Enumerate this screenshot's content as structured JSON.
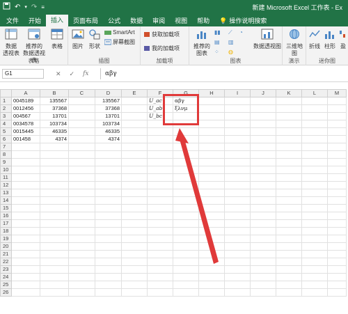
{
  "window": {
    "title": "新建 Microsoft Excel 工作表 - Ex"
  },
  "tabs": [
    {
      "label": "文件",
      "active": false
    },
    {
      "label": "开始",
      "active": false
    },
    {
      "label": "插入",
      "active": true
    },
    {
      "label": "页面布局",
      "active": false
    },
    {
      "label": "公式",
      "active": false
    },
    {
      "label": "数据",
      "active": false
    },
    {
      "label": "审阅",
      "active": false
    },
    {
      "label": "视图",
      "active": false
    },
    {
      "label": "帮助",
      "active": false
    },
    {
      "label": "操作说明搜索",
      "active": false
    }
  ],
  "ribbon": {
    "tables": {
      "btn1": "数据\n透视表",
      "btn2": "推荐的\n数据透视表",
      "btn3": "表格",
      "label": "表格"
    },
    "illustrations": {
      "btn1": "图片",
      "btn2": "形状",
      "smartart": "SmartArt",
      "screenshot": "屏幕截图",
      "label": "插图"
    },
    "addins": {
      "get": "获取加载项",
      "my": "我的加载项",
      "label": "加载项"
    },
    "charts": {
      "recommended": "推荐的\n图表",
      "pivotchart": "数据透视图",
      "label": "图表"
    },
    "tours": {
      "map3d": "三维地\n图",
      "label": "演示"
    },
    "sparklines": {
      "line": "折线",
      "column": "柱形",
      "winloss": "盈",
      "label": "迷你图"
    }
  },
  "formula_bar": {
    "name_box": "G1",
    "value": "αβγ",
    "fx": "fx"
  },
  "sheet": {
    "columns": [
      "A",
      "B",
      "C",
      "D",
      "E",
      "F",
      "G",
      "H",
      "I",
      "J",
      "K",
      "L",
      "M"
    ],
    "rows": [
      [
        "0045189",
        "135567",
        "",
        "135567",
        "",
        "U_ac",
        "αβγ",
        "",
        "",
        "",
        "",
        "",
        ""
      ],
      [
        "0012456",
        "37368",
        "",
        "37368",
        "",
        "U_ab",
        "ξλνμ",
        "",
        "",
        "",
        "",
        "",
        ""
      ],
      [
        "004567",
        "13701",
        "",
        "13701",
        "",
        "U_bc",
        "",
        "",
        "",
        "",
        "",
        "",
        ""
      ],
      [
        "0034578",
        "103734",
        "",
        "103734",
        "",
        "",
        "",
        "",
        "",
        "",
        "",
        "",
        ""
      ],
      [
        "0015445",
        "46335",
        "",
        "46335",
        "",
        "",
        "",
        "",
        "",
        "",
        "",
        "",
        ""
      ],
      [
        "001458",
        "4374",
        "",
        "4374",
        "",
        "",
        "",
        "",
        "",
        "",
        "",
        "",
        ""
      ],
      [
        "",
        "",
        "",
        "",
        "",
        "",
        "",
        "",
        "",
        "",
        "",
        "",
        ""
      ],
      [
        "",
        "",
        "",
        "",
        "",
        "",
        "",
        "",
        "",
        "",
        "",
        "",
        ""
      ],
      [
        "",
        "",
        "",
        "",
        "",
        "",
        "",
        "",
        "",
        "",
        "",
        "",
        ""
      ],
      [
        "",
        "",
        "",
        "",
        "",
        "",
        "",
        "",
        "",
        "",
        "",
        "",
        ""
      ],
      [
        "",
        "",
        "",
        "",
        "",
        "",
        "",
        "",
        "",
        "",
        "",
        "",
        ""
      ],
      [
        "",
        "",
        "",
        "",
        "",
        "",
        "",
        "",
        "",
        "",
        "",
        "",
        ""
      ],
      [
        "",
        "",
        "",
        "",
        "",
        "",
        "",
        "",
        "",
        "",
        "",
        "",
        ""
      ],
      [
        "",
        "",
        "",
        "",
        "",
        "",
        "",
        "",
        "",
        "",
        "",
        "",
        ""
      ],
      [
        "",
        "",
        "",
        "",
        "",
        "",
        "",
        "",
        "",
        "",
        "",
        "",
        ""
      ],
      [
        "",
        "",
        "",
        "",
        "",
        "",
        "",
        "",
        "",
        "",
        "",
        "",
        ""
      ],
      [
        "",
        "",
        "",
        "",
        "",
        "",
        "",
        "",
        "",
        "",
        "",
        "",
        ""
      ],
      [
        "",
        "",
        "",
        "",
        "",
        "",
        "",
        "",
        "",
        "",
        "",
        "",
        ""
      ],
      [
        "",
        "",
        "",
        "",
        "",
        "",
        "",
        "",
        "",
        "",
        "",
        "",
        ""
      ],
      [
        "",
        "",
        "",
        "",
        "",
        "",
        "",
        "",
        "",
        "",
        "",
        "",
        ""
      ],
      [
        "",
        "",
        "",
        "",
        "",
        "",
        "",
        "",
        "",
        "",
        "",
        "",
        ""
      ],
      [
        "",
        "",
        "",
        "",
        "",
        "",
        "",
        "",
        "",
        "",
        "",
        "",
        ""
      ],
      [
        "",
        "",
        "",
        "",
        "",
        "",
        "",
        "",
        "",
        "",
        "",
        "",
        ""
      ],
      [
        "",
        "",
        "",
        "",
        "",
        "",
        "",
        "",
        "",
        "",
        "",
        "",
        ""
      ],
      [
        "",
        "",
        "",
        "",
        "",
        "",
        "",
        "",
        "",
        "",
        "",
        "",
        ""
      ],
      [
        "",
        "",
        "",
        "",
        "",
        "",
        "",
        "",
        "",
        "",
        "",
        "",
        ""
      ]
    ]
  },
  "colors": {
    "excel_green": "#217346",
    "highlight_red": "#e03a3a"
  }
}
